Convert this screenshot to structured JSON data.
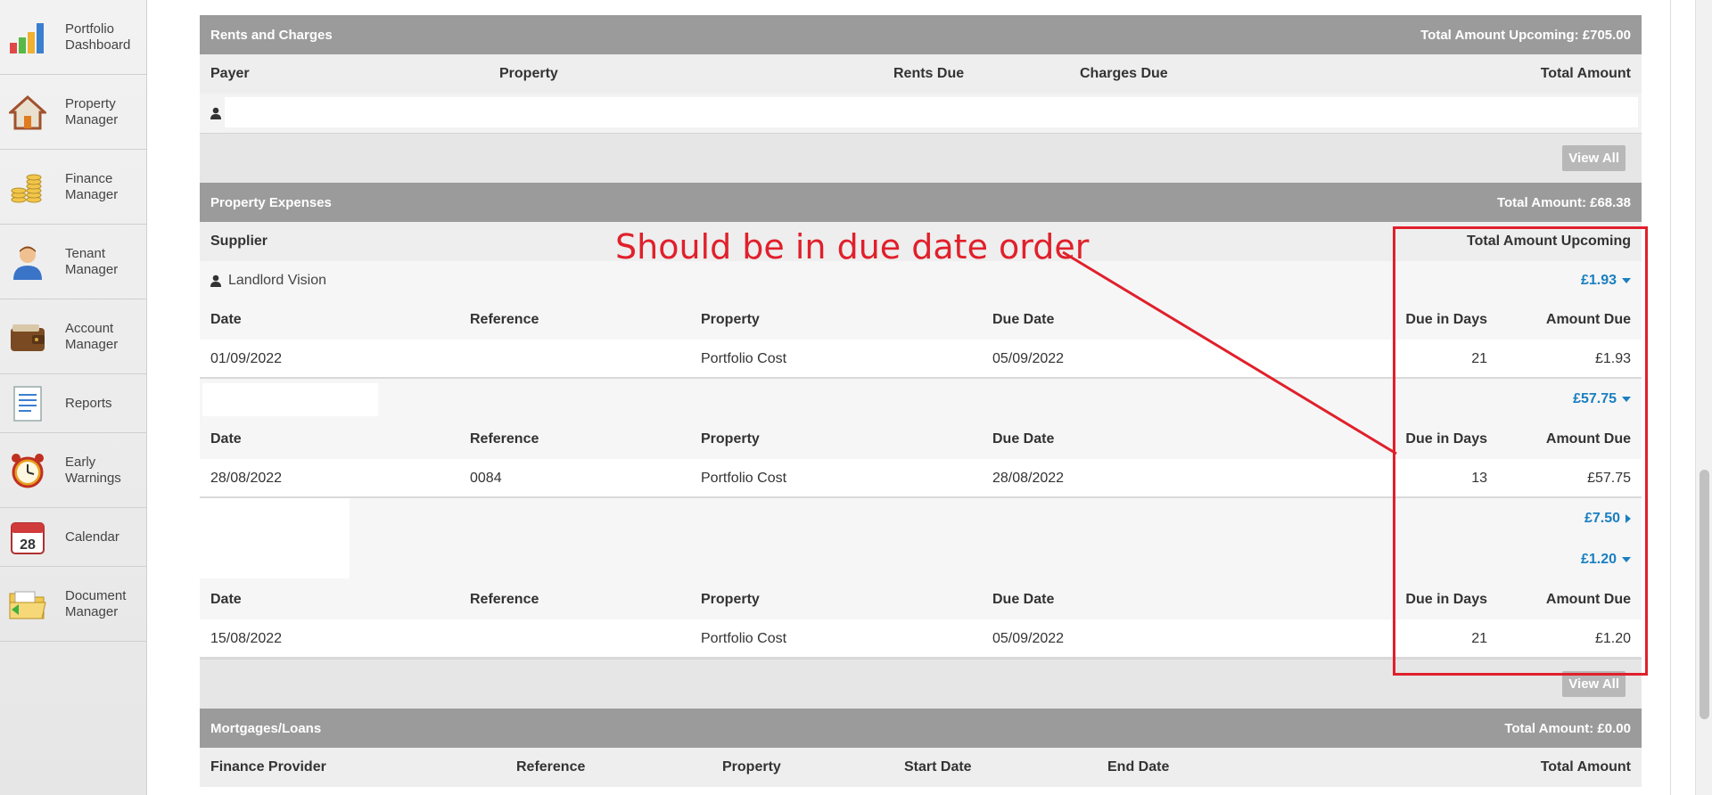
{
  "sidebar": {
    "items": [
      {
        "label": "Portfolio\nDashboard",
        "icon": "bar-chart-icon"
      },
      {
        "label": "Property\nManager",
        "icon": "house-icon"
      },
      {
        "label": "Finance\nManager",
        "icon": "coins-icon"
      },
      {
        "label": "Tenant\nManager",
        "icon": "person-icon"
      },
      {
        "label": "Account\nManager",
        "icon": "wallet-icon"
      },
      {
        "label": "Reports",
        "icon": "document-icon"
      },
      {
        "label": "Early\nWarnings",
        "icon": "alarm-clock-icon"
      },
      {
        "label": "Calendar",
        "icon": "calendar-icon"
      },
      {
        "label": "Document\nManager",
        "icon": "folder-icon"
      }
    ],
    "calendar_day": "28"
  },
  "rents": {
    "title": "Rents and Charges",
    "total": "Total Amount Upcoming: £705.00",
    "columns": {
      "payer": "Payer",
      "property": "Property",
      "rents_due": "Rents Due",
      "charges_due": "Charges Due",
      "total_amount": "Total Amount"
    },
    "view_all": "View All"
  },
  "expenses": {
    "title": "Property Expenses",
    "total": "Total Amount: £68.38",
    "columns": {
      "supplier": "Supplier",
      "total_upcoming": "Total Amount Upcoming"
    },
    "detail_columns": {
      "date": "Date",
      "reference": "Reference",
      "property": "Property",
      "due_date": "Due Date",
      "due_in_days": "Due in Days",
      "amount_due": "Amount Due"
    },
    "groups": [
      {
        "supplier": "Landlord Vision",
        "amount": "£1.93",
        "row": {
          "date": "01/09/2022",
          "reference": "",
          "property": "Portfolio Cost",
          "due_date": "05/09/2022",
          "due_in_days": "21",
          "amount_due": "£1.93"
        }
      },
      {
        "supplier": "",
        "amount": "£57.75",
        "row": {
          "date": "28/08/2022",
          "reference": "0084",
          "property": "Portfolio Cost",
          "due_date": "28/08/2022",
          "due_in_days": "13",
          "amount_due": "£57.75"
        }
      },
      {
        "supplier": "",
        "amount_collapsed": "£7.50",
        "amount": "£1.20",
        "row": {
          "date": "15/08/2022",
          "reference": "",
          "property": "Portfolio Cost",
          "due_date": "05/09/2022",
          "due_in_days": "21",
          "amount_due": "£1.20"
        }
      }
    ],
    "view_all": "View All"
  },
  "mortgages": {
    "title": "Mortgages/Loans",
    "total": "Total Amount: £0.00",
    "columns": {
      "finance_provider": "Finance Provider",
      "reference": "Reference",
      "property": "Property",
      "start_date": "Start Date",
      "end_date": "End Date",
      "total_amount": "Total Amount"
    }
  },
  "annotation": {
    "text": "Should be in due date order",
    "color": "#e0202b"
  }
}
